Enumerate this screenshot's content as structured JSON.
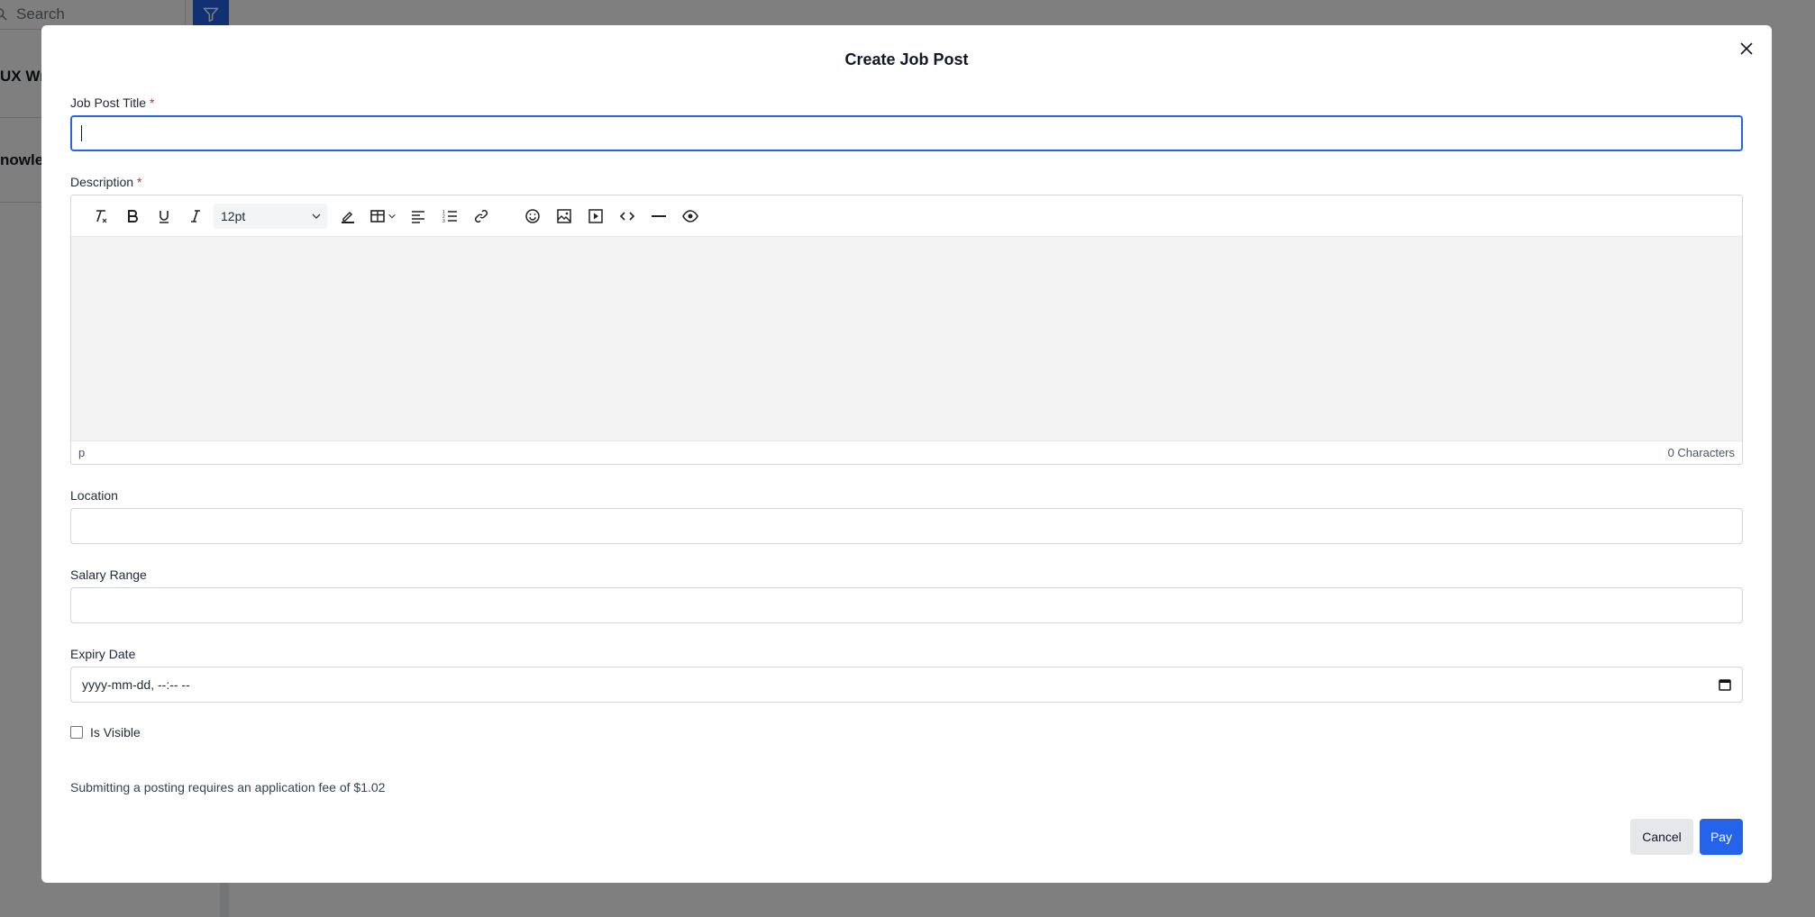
{
  "background": {
    "search_placeholder": "Search",
    "list_items": [
      "UX Writ",
      "nowle"
    ]
  },
  "modal": {
    "title": "Create Job Post",
    "fields": {
      "job_post_title": {
        "label": "Job Post Title",
        "required_mark": "*",
        "value": ""
      },
      "description": {
        "label": "Description",
        "required_mark": "*"
      },
      "location": {
        "label": "Location",
        "value": ""
      },
      "salary_range": {
        "label": "Salary Range",
        "value": ""
      },
      "expiry_date": {
        "label": "Expiry Date",
        "placeholder": "yyyy-mm-dd, --:-- --"
      }
    },
    "editor": {
      "font_size": "12pt",
      "status_path": "p",
      "char_count": "0 Characters"
    },
    "is_visible": {
      "label": "Is Visible",
      "checked": false
    },
    "fee_note": "Submitting a posting requires an application fee of $1.02",
    "buttons": {
      "cancel": "Cancel",
      "pay": "Pay"
    }
  },
  "colors": {
    "primary": "#2563eb",
    "required": "#dc2626",
    "overlay": "rgba(0,0,0,0.5)"
  }
}
